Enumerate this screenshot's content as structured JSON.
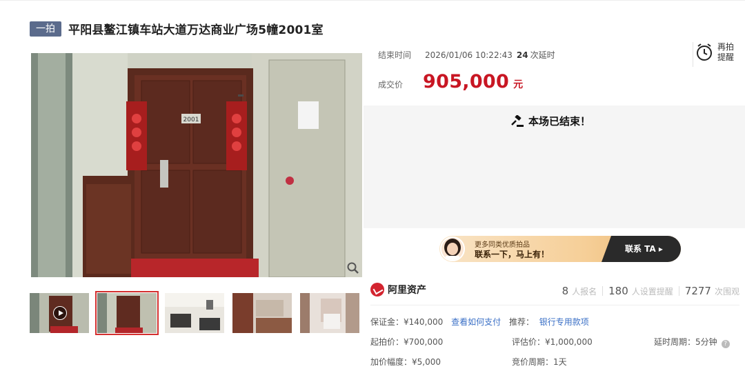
{
  "title": {
    "badge": "一拍",
    "text": "平阳县鳌江镇车站大道万达商业广场5幢2001室"
  },
  "auction": {
    "end_label": "结束时间",
    "end_time": "2026/01/06 10:22:43",
    "extend_count": "24",
    "extend_label": "次延时",
    "remind_label": "再拍提醒",
    "price_label": "成交价",
    "price": "905,000",
    "price_unit": "元",
    "status": "本场已结束！"
  },
  "banner": {
    "line1": "更多同类优质拍品",
    "line2": "联系一下，马上有！",
    "cta": "联系 TA ▸"
  },
  "platform": {
    "name": "阿里资产",
    "stats": [
      {
        "value": "8",
        "label": "人报名"
      },
      {
        "value": "180",
        "label": "人设置提醒"
      },
      {
        "value": "7277",
        "label": "次围观"
      }
    ]
  },
  "params": {
    "deposit": "保证金：¥140,000",
    "pay_link": "查看如何支付",
    "recommend_label": "推荐：",
    "recommend_link": "银行专用款项",
    "start_price": "起拍价：¥700,000",
    "appraisal": "评估价：¥1,000,000",
    "delay_period": "延时周期：5分钟",
    "increment": "加价幅度：¥5,000",
    "bid_period": "竞价周期：1天"
  },
  "photo": {
    "door_number": "2001"
  },
  "colors": {
    "accent_red": "#c81623",
    "badge": "#5b6b8c",
    "link": "#3a6fc6"
  }
}
